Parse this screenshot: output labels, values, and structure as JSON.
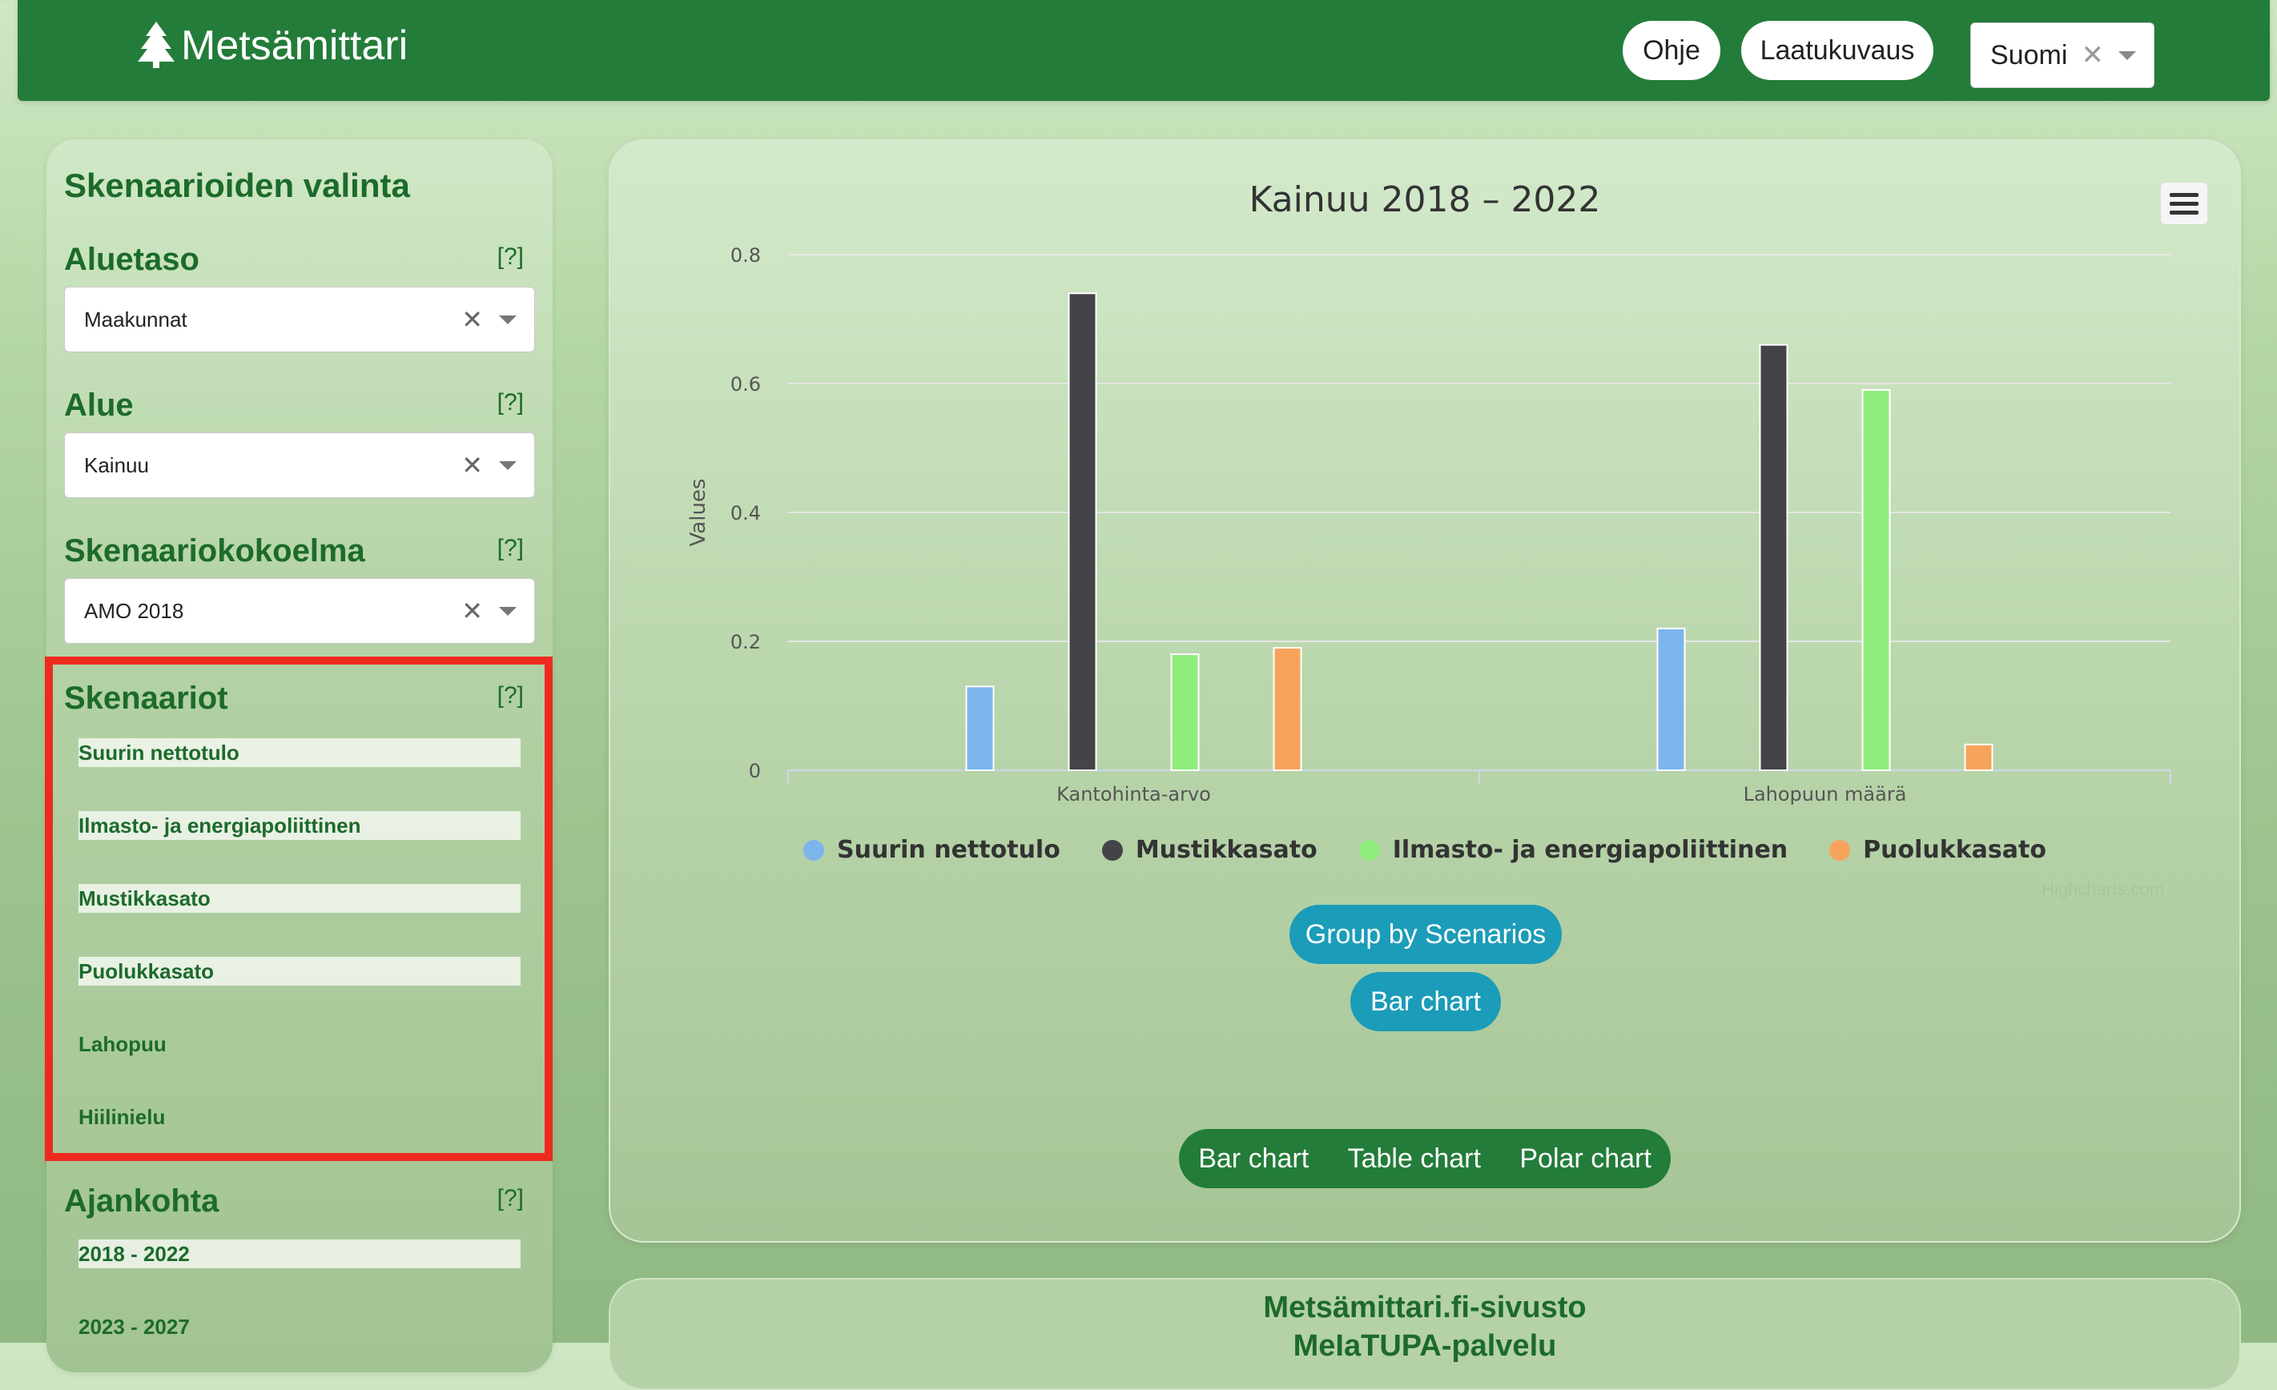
{
  "header": {
    "brand": "Metsämittari",
    "help_label": "Ohje",
    "quality_label": "Laatukuvaus",
    "language": "Suomi"
  },
  "sidebar": {
    "title": "Skenaarioiden valinta",
    "help_marker": "[?]",
    "aluetaso": {
      "label": "Aluetaso",
      "value": "Maakunnat"
    },
    "alue": {
      "label": "Alue",
      "value": "Kainuu"
    },
    "kokoelma": {
      "label": "Skenaariokokoelma",
      "value": "AMO 2018"
    },
    "skenaariot": {
      "label": "Skenaariot",
      "items": [
        {
          "label": "Suurin nettotulo",
          "selected": true
        },
        {
          "label": "Ilmasto- ja energiapoliittinen",
          "selected": true
        },
        {
          "label": "Mustikkasato",
          "selected": true
        },
        {
          "label": "Puolukkasato",
          "selected": true
        },
        {
          "label": "Lahopuu",
          "selected": false
        },
        {
          "label": "Hiilinielu",
          "selected": false
        }
      ]
    },
    "ajankohta": {
      "label": "Ajankohta",
      "items": [
        {
          "label": "2018 - 2022",
          "selected": true
        },
        {
          "label": "2023 - 2027",
          "selected": false
        }
      ]
    }
  },
  "chart": {
    "credits": "Highcharts.com",
    "group_button": "Group by Scenarios",
    "type_button": "Bar chart",
    "view_tabs": [
      "Bar chart",
      "Table chart",
      "Polar chart"
    ]
  },
  "chart_data": {
    "type": "bar",
    "title": "Kainuu 2018 – 2022",
    "xlabel": "",
    "ylabel": "Values",
    "categories": [
      "Kantohinta-arvo",
      "Lahopuun määrä"
    ],
    "ylim": [
      0,
      0.8
    ],
    "yticks": [
      "0",
      "0.2",
      "0.4",
      "0.6",
      "0.8"
    ],
    "grid": true,
    "legend_position": "bottom",
    "series": [
      {
        "name": "Suurin nettotulo",
        "color": "#7cb5ec",
        "values": [
          0.13,
          0.22
        ]
      },
      {
        "name": "Mustikkasato",
        "color": "#434348",
        "values": [
          0.74,
          0.66
        ]
      },
      {
        "name": "Ilmasto- ja energiapoliittinen",
        "color": "#90ed7d",
        "values": [
          0.18,
          0.59
        ]
      },
      {
        "name": "Puolukkasato",
        "color": "#f7a35c",
        "values": [
          0.19,
          0.04
        ]
      }
    ]
  },
  "footer": {
    "line1": "Metsämittari.fi-sivusto",
    "line2": "MeIaTUPA-palvelu"
  }
}
